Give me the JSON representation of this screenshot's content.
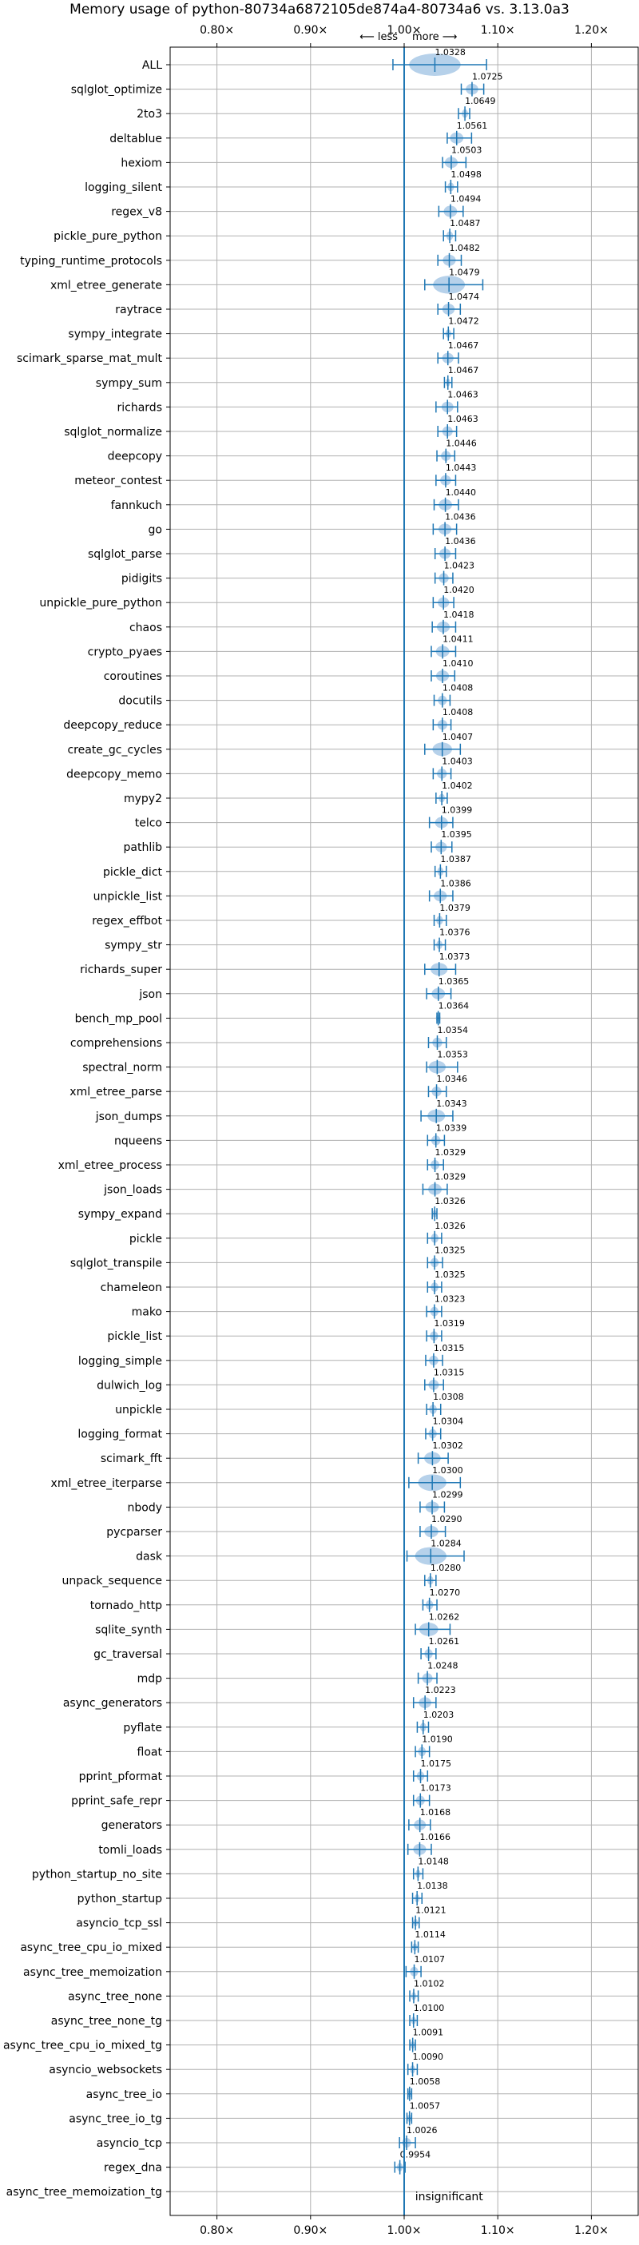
{
  "chart_data": {
    "type": "violin",
    "title": "Memory usage of python-80734a6872105de874a4-80734a6 vs. 3.13.0a3",
    "xlim": [
      0.75,
      1.25
    ],
    "xticks": [
      0.8,
      0.9,
      1.0,
      1.1,
      1.2
    ],
    "xtick_labels": [
      "0.80×",
      "0.90×",
      "1.00×",
      "1.10×",
      "1.20×"
    ],
    "direction_labels": {
      "less": "⟵ less",
      "more": "more ⟶"
    },
    "grid": true,
    "reference_line": 1.0,
    "footer_note": "insignificant",
    "categories": [
      "ALL",
      "sqlglot_optimize",
      "2to3",
      "deltablue",
      "hexiom",
      "logging_silent",
      "regex_v8",
      "pickle_pure_python",
      "typing_runtime_protocols",
      "xml_etree_generate",
      "raytrace",
      "sympy_integrate",
      "scimark_sparse_mat_mult",
      "sympy_sum",
      "richards",
      "sqlglot_normalize",
      "deepcopy",
      "meteor_contest",
      "fannkuch",
      "go",
      "sqlglot_parse",
      "pidigits",
      "unpickle_pure_python",
      "chaos",
      "crypto_pyaes",
      "coroutines",
      "docutils",
      "deepcopy_reduce",
      "create_gc_cycles",
      "deepcopy_memo",
      "mypy2",
      "telco",
      "pathlib",
      "pickle_dict",
      "unpickle_list",
      "regex_effbot",
      "sympy_str",
      "richards_super",
      "json",
      "bench_mp_pool",
      "comprehensions",
      "spectral_norm",
      "xml_etree_parse",
      "json_dumps",
      "nqueens",
      "xml_etree_process",
      "json_loads",
      "sympy_expand",
      "pickle",
      "sqlglot_transpile",
      "chameleon",
      "mako",
      "pickle_list",
      "logging_simple",
      "dulwich_log",
      "unpickle",
      "logging_format",
      "scimark_fft",
      "xml_etree_iterparse",
      "nbody",
      "pycparser",
      "dask",
      "unpack_sequence",
      "tornado_http",
      "sqlite_synth",
      "gc_traversal",
      "mdp",
      "async_generators",
      "pyflate",
      "float",
      "pprint_pformat",
      "pprint_safe_repr",
      "generators",
      "tomli_loads",
      "python_startup_no_site",
      "python_startup",
      "asyncio_tcp_ssl",
      "async_tree_cpu_io_mixed",
      "async_tree_memoization",
      "async_tree_none",
      "async_tree_none_tg",
      "async_tree_cpu_io_mixed_tg",
      "asyncio_websockets",
      "async_tree_io",
      "async_tree_io_tg",
      "asyncio_tcp",
      "regex_dna",
      "async_tree_memoization_tg"
    ],
    "values": [
      1.0328,
      1.0725,
      1.0649,
      1.0561,
      1.0503,
      1.0498,
      1.0494,
      1.0487,
      1.0482,
      1.0479,
      1.0474,
      1.0472,
      1.0467,
      1.0467,
      1.0463,
      1.0463,
      1.0446,
      1.0443,
      1.044,
      1.0436,
      1.0436,
      1.0423,
      1.042,
      1.0418,
      1.0411,
      1.041,
      1.0408,
      1.0408,
      1.0407,
      1.0403,
      1.0402,
      1.0399,
      1.0395,
      1.0387,
      1.0386,
      1.0379,
      1.0376,
      1.0373,
      1.0365,
      1.0364,
      1.0354,
      1.0353,
      1.0346,
      1.0343,
      1.0339,
      1.0329,
      1.0329,
      1.0326,
      1.0326,
      1.0325,
      1.0325,
      1.0323,
      1.0319,
      1.0315,
      1.0315,
      1.0308,
      1.0304,
      1.0302,
      1.03,
      1.0299,
      1.029,
      1.0284,
      1.028,
      1.027,
      1.0262,
      1.0261,
      1.0248,
      1.0223,
      1.0203,
      1.019,
      1.0175,
      1.0173,
      1.0168,
      1.0166,
      1.0148,
      1.0138,
      1.0121,
      1.0114,
      1.0107,
      1.0102,
      1.01,
      1.0091,
      1.009,
      1.0058,
      1.0057,
      1.0026,
      0.9954,
      null
    ],
    "value_labels": [
      "1.0328",
      "1.0725",
      "1.0649",
      "1.0561",
      "1.0503",
      "1.0498",
      "1.0494",
      "1.0487",
      "1.0482",
      "1.0479",
      "1.0474",
      "1.0472",
      "1.0467",
      "1.0467",
      "1.0463",
      "1.0463",
      "1.0446",
      "1.0443",
      "1.0440",
      "1.0436",
      "1.0436",
      "1.0423",
      "1.0420",
      "1.0418",
      "1.0411",
      "1.0410",
      "1.0408",
      "1.0408",
      "1.0407",
      "1.0403",
      "1.0402",
      "1.0399",
      "1.0395",
      "1.0387",
      "1.0386",
      "1.0379",
      "1.0376",
      "1.0373",
      "1.0365",
      "1.0364",
      "1.0354",
      "1.0353",
      "1.0346",
      "1.0343",
      "1.0339",
      "1.0329",
      "1.0329",
      "1.0326",
      "1.0326",
      "1.0325",
      "1.0325",
      "1.0323",
      "1.0319",
      "1.0315",
      "1.0315",
      "1.0308",
      "1.0304",
      "1.0302",
      "1.0300",
      "1.0299",
      "1.0290",
      "1.0284",
      "1.0280",
      "1.0270",
      "1.0262",
      "1.0261",
      "1.0248",
      "1.0223",
      "1.0203",
      "1.0190",
      "1.0175",
      "1.0173",
      "1.0168",
      "1.0166",
      "1.0148",
      "1.0138",
      "1.0121",
      "1.0114",
      "1.0107",
      "1.0102",
      "1.0100",
      "1.0091",
      "1.0090",
      "1.0058",
      "1.0057",
      "1.0026",
      "0.9954",
      ""
    ],
    "ranges": [
      [
        0.988,
        1.088
      ],
      [
        1.061,
        1.085
      ],
      [
        1.058,
        1.07
      ],
      [
        1.046,
        1.072
      ],
      [
        1.041,
        1.066
      ],
      [
        1.044,
        1.057
      ],
      [
        1.037,
        1.063
      ],
      [
        1.042,
        1.055
      ],
      [
        1.036,
        1.061
      ],
      [
        1.022,
        1.084
      ],
      [
        1.036,
        1.06
      ],
      [
        1.042,
        1.053
      ],
      [
        1.036,
        1.058
      ],
      [
        1.043,
        1.051
      ],
      [
        1.034,
        1.057
      ],
      [
        1.036,
        1.056
      ],
      [
        1.035,
        1.054
      ],
      [
        1.034,
        1.055
      ],
      [
        1.032,
        1.058
      ],
      [
        1.031,
        1.056
      ],
      [
        1.033,
        1.055
      ],
      [
        1.033,
        1.052
      ],
      [
        1.031,
        1.053
      ],
      [
        1.03,
        1.055
      ],
      [
        1.029,
        1.055
      ],
      [
        1.029,
        1.054
      ],
      [
        1.032,
        1.049
      ],
      [
        1.031,
        1.05
      ],
      [
        1.022,
        1.06
      ],
      [
        1.031,
        1.05
      ],
      [
        1.034,
        1.046
      ],
      [
        1.027,
        1.052
      ],
      [
        1.029,
        1.051
      ],
      [
        1.033,
        1.045
      ],
      [
        1.027,
        1.052
      ],
      [
        1.032,
        1.045
      ],
      [
        1.032,
        1.044
      ],
      [
        1.022,
        1.055
      ],
      [
        1.024,
        1.05
      ],
      [
        1.035,
        1.038
      ],
      [
        1.026,
        1.045
      ],
      [
        1.024,
        1.057
      ],
      [
        1.026,
        1.045
      ],
      [
        1.018,
        1.052
      ],
      [
        1.025,
        1.043
      ],
      [
        1.025,
        1.042
      ],
      [
        1.02,
        1.046
      ],
      [
        1.03,
        1.035
      ],
      [
        1.025,
        1.04
      ],
      [
        1.025,
        1.041
      ],
      [
        1.025,
        1.04
      ],
      [
        1.024,
        1.04
      ],
      [
        1.024,
        1.04
      ],
      [
        1.023,
        1.041
      ],
      [
        1.022,
        1.042
      ],
      [
        1.024,
        1.039
      ],
      [
        1.023,
        1.039
      ],
      [
        1.015,
        1.047
      ],
      [
        1.005,
        1.06
      ],
      [
        1.017,
        1.043
      ],
      [
        1.017,
        1.044
      ],
      [
        1.003,
        1.064
      ],
      [
        1.022,
        1.034
      ],
      [
        1.02,
        1.035
      ],
      [
        1.012,
        1.049
      ],
      [
        1.018,
        1.034
      ],
      [
        1.015,
        1.035
      ],
      [
        1.01,
        1.034
      ],
      [
        1.014,
        1.026
      ],
      [
        1.012,
        1.027
      ],
      [
        1.01,
        1.025
      ],
      [
        1.01,
        1.027
      ],
      [
        1.005,
        1.028
      ],
      [
        1.004,
        1.029
      ],
      [
        1.01,
        1.02
      ],
      [
        1.009,
        1.019
      ],
      [
        1.009,
        1.016
      ],
      [
        1.008,
        1.015
      ],
      [
        1.002,
        1.018
      ],
      [
        1.006,
        1.015
      ],
      [
        1.006,
        1.014
      ],
      [
        1.006,
        1.012
      ],
      [
        1.004,
        1.014
      ],
      [
        1.004,
        1.008
      ],
      [
        1.003,
        1.008
      ],
      [
        0.995,
        1.012
      ],
      [
        0.99,
        1.001
      ],
      [
        null,
        null
      ]
    ]
  },
  "colors": {
    "body": "#a9c9e6",
    "line": "#1f77b4",
    "grid": "#b0b0b0",
    "frame": "#000000"
  }
}
